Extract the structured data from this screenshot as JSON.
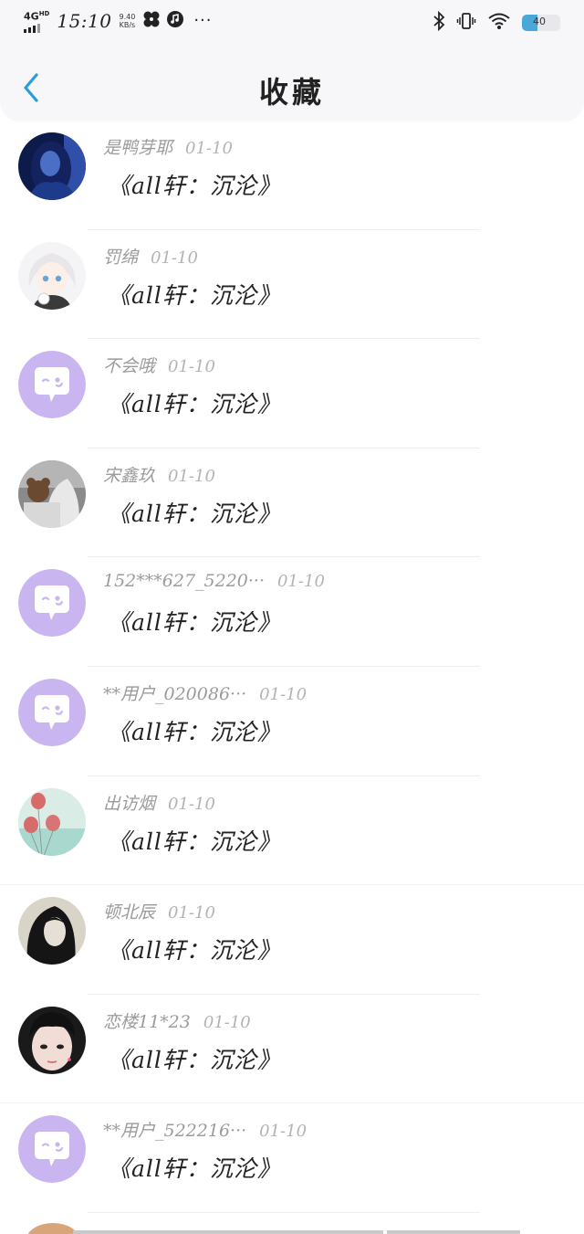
{
  "status_bar": {
    "network": "4G",
    "network_sup": "HD",
    "time": "15:10",
    "speed_value": "9.40",
    "speed_unit": "KB/s",
    "battery": "40"
  },
  "header": {
    "title": "收藏"
  },
  "colors": {
    "accent": "#2a9cd8",
    "default_avatar": "#c9b6f0"
  },
  "favorites": [
    {
      "user": "是鸭芽耶",
      "date": "01-10",
      "work": "《all轩：沉沦》",
      "avatar": "photo-blue"
    },
    {
      "user": "罚绵",
      "date": "01-10",
      "work": "《all轩：沉沦》",
      "avatar": "anime-girl"
    },
    {
      "user": "不会哦",
      "date": "01-10",
      "work": "《all轩：沉沦》",
      "avatar": "default"
    },
    {
      "user": "宋鑫玖",
      "date": "01-10",
      "work": "《all轩：沉沦》",
      "avatar": "photo-bear"
    },
    {
      "user": "152***627_5220···",
      "date": "01-10",
      "work": "《all轩：沉沦》",
      "avatar": "default"
    },
    {
      "user": "**用户_020086···",
      "date": "01-10",
      "work": "《all轩：沉沦》",
      "avatar": "default"
    },
    {
      "user": "出访烟",
      "date": "01-10",
      "work": "《all轩：沉沦》",
      "avatar": "balloons"
    },
    {
      "user": "顿北辰",
      "date": "01-10",
      "work": "《all轩：沉沦》",
      "avatar": "photo-dark"
    },
    {
      "user": "恋楼11*23",
      "date": "01-10",
      "work": "《all轩：沉沦》",
      "avatar": "photo-face"
    },
    {
      "user": "**用户_522216···",
      "date": "01-10",
      "work": "《all轩：沉沦》",
      "avatar": "default"
    }
  ]
}
